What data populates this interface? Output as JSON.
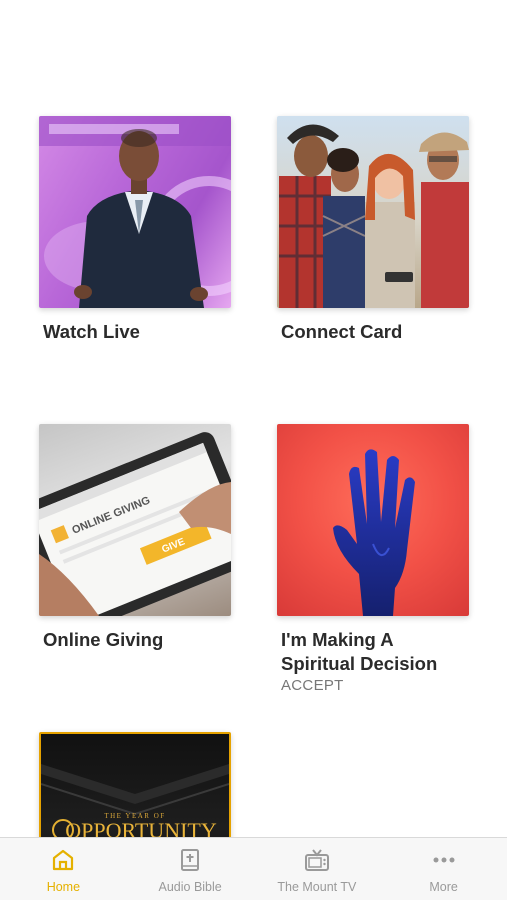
{
  "colors": {
    "accent": "#e5b100",
    "inactive_tab": "#9a9a9a",
    "title_text": "#2b2b2b",
    "subtitle_text": "#777777",
    "tab_bar_bg": "#f7f7f7"
  },
  "cards": [
    {
      "title": "Watch Live",
      "subtitle": ""
    },
    {
      "title": "Connect Card",
      "subtitle": ""
    },
    {
      "title": "Online Giving",
      "subtitle": ""
    },
    {
      "title": "I'm Making A Spiritual Decision",
      "subtitle": "ACCEPT"
    },
    {
      "title": "",
      "subtitle": ""
    }
  ],
  "thumbnails": {
    "giving": {
      "screen_text": "ONLINE GIVING",
      "button_text": "GIVE"
    },
    "opportunity": {
      "line1": "THE YEAR OF",
      "line2": "OPPORTUNITY"
    }
  },
  "tabs": [
    {
      "label": "Home",
      "icon": "home-icon",
      "active": true
    },
    {
      "label": "Audio Bible",
      "icon": "bible-icon",
      "active": false
    },
    {
      "label": "The Mount TV",
      "icon": "tv-icon",
      "active": false
    },
    {
      "label": "More",
      "icon": "more-icon",
      "active": false
    }
  ]
}
